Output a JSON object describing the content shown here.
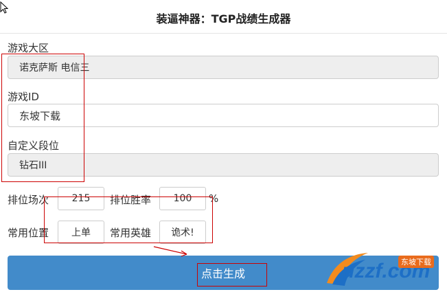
{
  "header": {
    "title": "装逼神器：TGP战绩生成器"
  },
  "form": {
    "region_label": "游戏大区",
    "region_value": "诺克萨斯 电信三",
    "game_id_label": "游戏ID",
    "game_id_value": "东坡下载",
    "rank_label": "自定义段位",
    "rank_value": "钻石III",
    "matches_label": "排位场次",
    "matches_value": "215",
    "winrate_label": "排位胜率",
    "winrate_value": "100",
    "percent_sign": "%",
    "position_label": "常用位置",
    "position_value": "上单",
    "hero_label": "常用英雄",
    "hero_value": "诡术!"
  },
  "actions": {
    "generate_label": "点击生成"
  },
  "watermark": {
    "logo_text": "uzzf.com",
    "badge_text": "东坡下载"
  },
  "colors": {
    "button_bg": "#428bca",
    "annotation": "#cc0000"
  }
}
